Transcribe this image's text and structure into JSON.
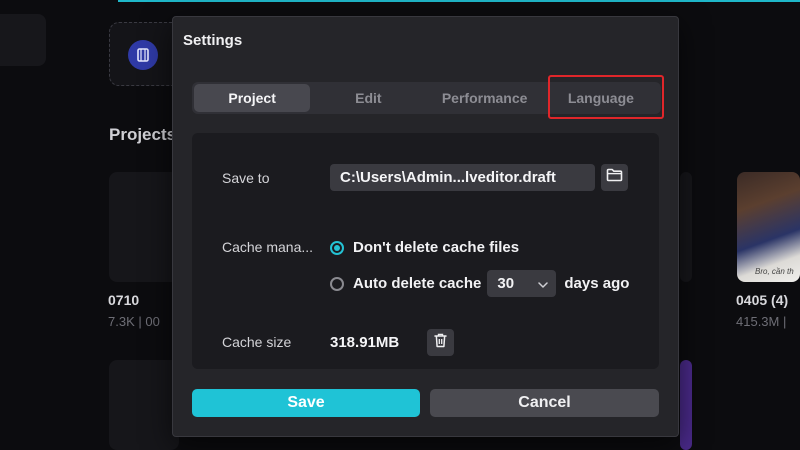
{
  "background": {
    "projects_title": "Projects",
    "projects": [
      {
        "name": "0710",
        "meta": "7.3K | 00"
      },
      {
        "name": "0405 (4)",
        "meta": "415.3M |"
      }
    ],
    "thumb_caption": "Bro, cần th"
  },
  "dialog": {
    "title": "Settings",
    "tabs": [
      {
        "label": "Project",
        "active": true
      },
      {
        "label": "Edit",
        "active": false
      },
      {
        "label": "Performance",
        "active": false
      },
      {
        "label": "Language",
        "active": false
      }
    ],
    "save_to": {
      "label": "Save to",
      "path": "C:\\Users\\Admin...lveditor.draft"
    },
    "cache_management": {
      "label": "Cache mana...",
      "option_keep": "Don't delete cache files",
      "option_auto": "Auto delete cache",
      "days_value": "30",
      "days_suffix": "days ago",
      "selected": "keep"
    },
    "cache_size": {
      "label": "Cache size",
      "value": "318.91MB"
    },
    "buttons": {
      "save": "Save",
      "cancel": "Cancel"
    }
  },
  "colors": {
    "accent": "#1fc3d6",
    "highlight_box": "#e0262a"
  },
  "icons": {
    "browse": "folder-icon",
    "clear_cache": "trash-icon",
    "select_arrow": "chevron-down-icon",
    "create": "film-icon"
  }
}
